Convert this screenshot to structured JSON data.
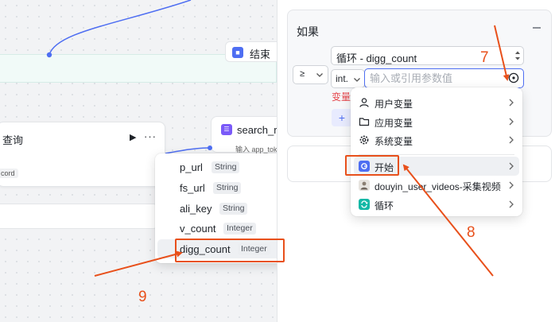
{
  "canvas": {
    "end_node": {
      "label": "结束"
    },
    "query_node": {
      "title": "查询",
      "tag": "cord"
    },
    "search_node": {
      "label": "search_re",
      "tag": "输入 app_toke"
    }
  },
  "variable_menu": {
    "items": [
      {
        "name": "p_url",
        "type": "String"
      },
      {
        "name": "fs_url",
        "type": "String"
      },
      {
        "name": "ali_key",
        "type": "String"
      },
      {
        "name": "v_count",
        "type": "Integer"
      },
      {
        "name": "digg_count",
        "type": "Integer"
      }
    ],
    "active_index": 4
  },
  "panel": {
    "condition_title": "如果",
    "operator": "≥",
    "left_value": "循环 - digg_count",
    "value_type": "int.",
    "value_placeholder": "输入或引用参数值",
    "error_text": "变量",
    "add_button": "+"
  },
  "source_menu": {
    "items": [
      {
        "label": "用户变量",
        "icon": "user-icon"
      },
      {
        "label": "应用变量",
        "icon": "folder-icon"
      },
      {
        "label": "系统变量",
        "icon": "gear-icon"
      },
      {
        "label": "开始",
        "icon": "start-icon"
      },
      {
        "label": "douyin_user_videos-采集视频",
        "icon": "video-plugin-icon"
      },
      {
        "label": "循环",
        "icon": "loop-icon"
      }
    ],
    "active_index": 3
  },
  "annotations": {
    "n7": "7",
    "n8": "8",
    "n9": "9"
  },
  "colors": {
    "accent": "#4e6ef2",
    "annotation": "#e8501b",
    "error": "#e5484d"
  }
}
